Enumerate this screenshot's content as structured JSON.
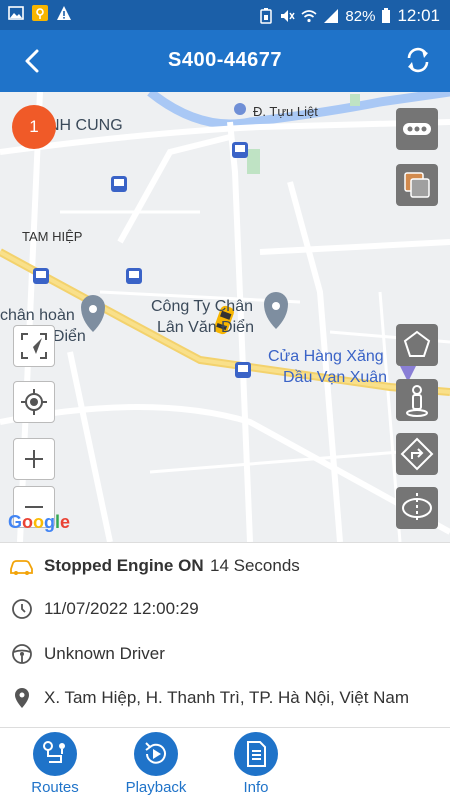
{
  "status_bar": {
    "battery": "82%",
    "time": "12:01"
  },
  "app_bar": {
    "title": "S400-44677"
  },
  "map": {
    "badge_count": "1",
    "labels": {
      "street": "Đ. Tựu Liệt",
      "area1": "NH CUNG",
      "area2": "TAM HIỆP",
      "poi1_line1": "Công Ty Chân",
      "poi1_line2": "Lân Văn Điển",
      "poi2_line1": "chân hoàn",
      "poi2_line2": "Văn Điển",
      "poi3_line1": "Cửa Hàng Xăng",
      "poi3_line2": "Dầu Vạn Xuân"
    },
    "attribution": "Google"
  },
  "info": {
    "status": "Stopped Engine ON",
    "duration": "14 Seconds",
    "datetime": "11/07/2022 12:00:29",
    "driver": "Unknown Driver",
    "address": "X. Tam Hiệp, H. Thanh Trì, TP. Hà Nội, Việt Nam"
  },
  "bottom_nav": [
    {
      "label": "Routes"
    },
    {
      "label": "Playback"
    },
    {
      "label": "Info"
    }
  ],
  "colors": {
    "primary": "#1f73c9",
    "status_orange": "#f2a40a",
    "badge": "#f05a28"
  }
}
